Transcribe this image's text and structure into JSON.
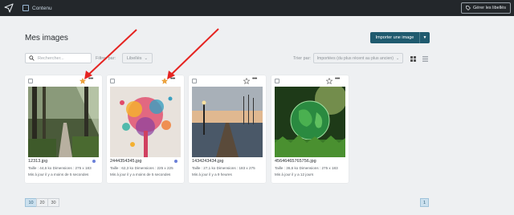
{
  "header": {
    "nav_label": "Contenu",
    "manage_tags_label": "Gérer les libellés"
  },
  "page": {
    "title": "Mes images",
    "import_button_label": "Importer une image"
  },
  "toolbar": {
    "search_placeholder": "Rechercher...",
    "filter_label": "Filtrer par:",
    "filter_value": "Libellés",
    "sort_label": "Trier par:",
    "sort_value": "Importées (du plus récent au plus ancien)"
  },
  "images": [
    {
      "filename": "12313.jpg",
      "meta": "Taille : 44,6 ko   Dimensions : 275 x 183",
      "updated": "Mis à jour il y a moins de 5 secondes",
      "starred": true,
      "has_dot": true
    },
    {
      "filename": "2444354345.jpg",
      "meta": "Taille : 62,3 ko   Dimensions : 225 x 225",
      "updated": "Mis à jour il y a moins de 5 secondes",
      "starred": true,
      "has_dot": true
    },
    {
      "filename": "1434243434.jpg",
      "meta": "Taille : 27,1 ko   Dimensions : 183 x 275",
      "updated": "Mis à jour il y a 9 heures",
      "starred": false,
      "has_dot": false
    },
    {
      "filename": "45646465765756.jpg",
      "meta": "Taille : 36,6 ko   Dimensions : 275 x 183",
      "updated": "Mis à jour il y a 12 jours",
      "starred": false,
      "has_dot": false
    }
  ],
  "pagination": {
    "page_sizes": [
      "10",
      "20",
      "30"
    ],
    "current_page": "1"
  },
  "colors": {
    "topbar": "#23272b",
    "primary": "#1f5a6e",
    "star_active": "#f0a33a",
    "annotation_arrow": "#e52421"
  }
}
